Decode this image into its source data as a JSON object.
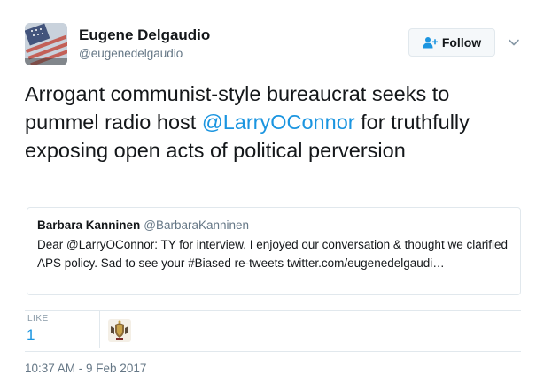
{
  "author": {
    "name": "Eugene Delgaudio",
    "handle": "@eugenedelgaudio"
  },
  "follow_button": {
    "label": "Follow"
  },
  "tweet": {
    "text_before": "Arrogant communist-style bureaucrat seeks to pummel radio host ",
    "mention": "@LarryOConnor",
    "text_after": " for truthfully exposing open acts of political perversion"
  },
  "quoted_tweet": {
    "name": "Barbara Kanninen",
    "handle": "@BarbaraKanninen",
    "text": "Dear @LarryOConnor: TY for interview. I enjoyed our conversation & thought we clarified APS policy. Sad to see your #Biased re-tweets twitter.com/eugenedelgaudi…"
  },
  "stats": {
    "like_label": "LIKE",
    "like_count": "1"
  },
  "timestamp": "10:37 AM - 9 Feb 2017",
  "colors": {
    "link": "#1b95e0",
    "secondary_text": "#657786",
    "border": "#e1e8ed"
  },
  "icons": {
    "follow": "person-add-icon",
    "menu": "chevron-down-icon",
    "liker_avatar": "crest-avatar"
  }
}
